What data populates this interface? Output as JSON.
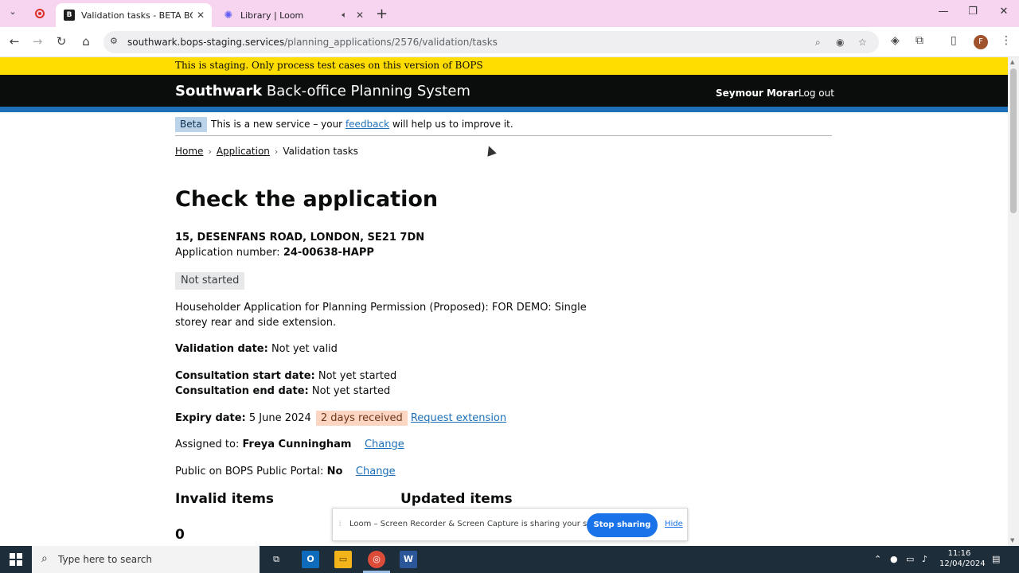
{
  "browser": {
    "tabs": [
      {
        "title": "Validation tasks - BETA BOPs - (",
        "icon": "bops-favicon"
      },
      {
        "title": "Library | Loom",
        "icon": "loom-favicon"
      }
    ],
    "url_host": "southwark.bops-staging.services",
    "url_path": "/planning_applications/2576/validation/tasks",
    "profile_initial": "F"
  },
  "banner": {
    "staging_text": "This is staging. Only process test cases on this version of BOPS"
  },
  "header": {
    "brand_bold": "Southwark",
    "brand_rest": "Back-office Planning System",
    "user_name": "Seymour Morar",
    "logout": "Log out"
  },
  "phase": {
    "tag": "Beta",
    "text_before": "This is a new service – your",
    "link": "feedback",
    "text_after": "will help us to improve it."
  },
  "breadcrumbs": {
    "home": "Home",
    "application": "Application",
    "current": "Validation tasks"
  },
  "main": {
    "title": "Check the application",
    "address": "15, DESENFANS ROAD, LONDON, SE21 7DN",
    "app_number_label": "Application number:",
    "app_number": "24-00638-HAPP",
    "status": "Not started",
    "description": "Householder Application for Planning Permission (Proposed): FOR DEMO: Single storey rear and side extension.",
    "validation_label": "Validation date:",
    "validation_value": "Not yet valid",
    "consult_start_label": "Consultation start date:",
    "consult_start_value": "Not yet started",
    "consult_end_label": "Consultation end date:",
    "consult_end_value": "Not yet started",
    "expiry_label": "Expiry date:",
    "expiry_value": "5 June 2024",
    "days_tag": "2 days received",
    "request_extension": "Request extension",
    "assigned_label": "Assigned to:",
    "assigned_value": "Freya Cunningham",
    "change_label": "Change",
    "public_label": "Public on BOPS Public Portal:",
    "public_value": "No",
    "invalid_heading": "Invalid items",
    "updated_heading": "Updated items",
    "invalid_count": "0"
  },
  "loom": {
    "message": "Loom – Screen Recorder & Screen Capture is sharing your screen.",
    "stop": "Stop sharing",
    "hide": "Hide"
  },
  "taskbar": {
    "search_placeholder": "Type here to search",
    "time": "11:16",
    "date": "12/04/2024"
  },
  "colors": {
    "staging_yellow": "#ffdd00",
    "header_black": "#0b0c0c",
    "gov_blue": "#1d70b8",
    "tab_strip_pink": "#f7d4ef"
  }
}
